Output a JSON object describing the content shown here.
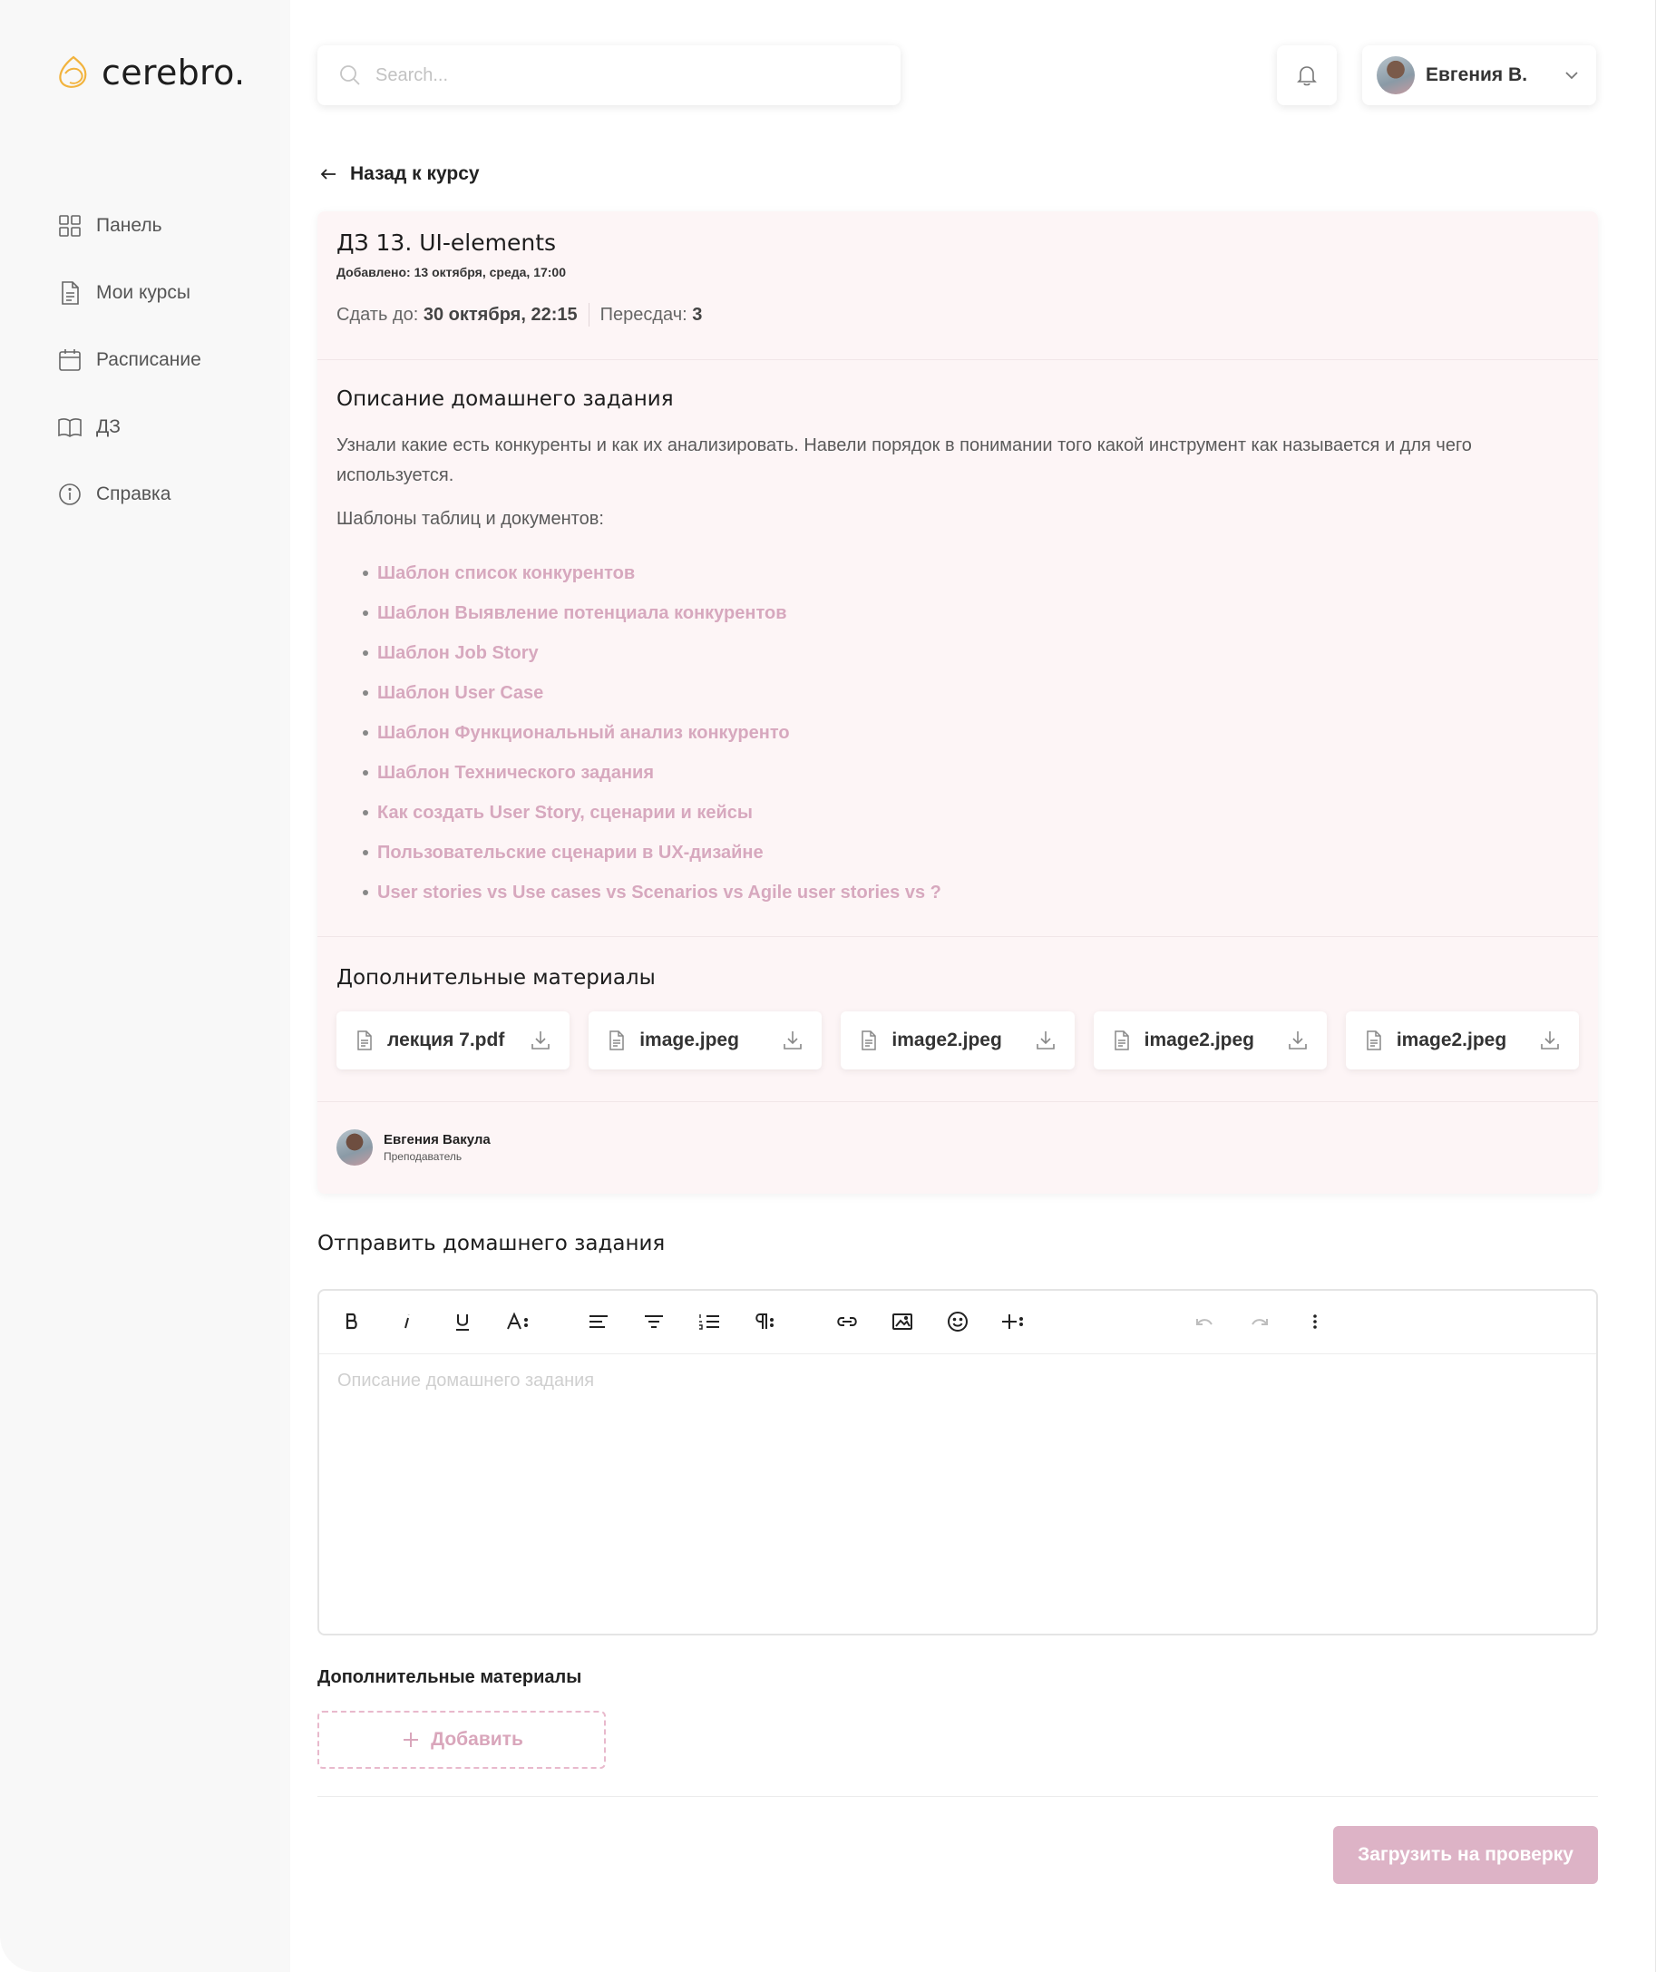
{
  "app": {
    "logo_text": "cerebro."
  },
  "sidebar": {
    "items": [
      {
        "label": "Панель",
        "icon": "grid-icon"
      },
      {
        "label": "Мои курсы",
        "icon": "document-icon"
      },
      {
        "label": "Расписание",
        "icon": "calendar-icon"
      },
      {
        "label": "ДЗ",
        "icon": "book-icon"
      },
      {
        "label": "Справка",
        "icon": "info-icon"
      }
    ]
  },
  "header": {
    "search_placeholder": "Search...",
    "user_name": "Евгения В."
  },
  "back_label": "Назад к курсу",
  "assignment": {
    "title": "ДЗ 13. UI-elements",
    "added": "Добавлено: 13 октября, среда, 17:00",
    "deadline_label": "Сдать до:",
    "deadline_value": "30 октября, 22:15",
    "retakes_label": "Пересдач:",
    "retakes_value": "3",
    "description_heading": "Описание домашнего задания",
    "description_text": "Узнали какие есть конкуренты и как их анализировать. Навели порядок в понимании того какой инструмент как называется и для чего используется.",
    "templates_label": "Шаблоны таблиц и документов:",
    "links": [
      "Шаблон список конкурентов",
      "Шаблон Выявление потенциала конкурентов",
      "Шаблон Job Story",
      "Шаблон User Case",
      "Шаблон Функциональный анализ конкуренто",
      "Шаблон Технического задания",
      "Как создать User Story, сценарии и кейсы",
      "Пользовательские сценарии в UX-дизайне",
      "User stories vs Use cases vs Scenarios vs Agile user stories vs ?"
    ],
    "materials_heading": "Дополнительные материалы",
    "files": [
      "лекция 7.pdf",
      "image.jpeg",
      "image2.jpeg",
      "image2.jpeg",
      "image2.jpeg"
    ],
    "author_name": "Евгения Вакула",
    "author_role": "Преподаватель"
  },
  "submit": {
    "title": "Отправить домашнего задания",
    "editor_placeholder": "Описание домашнего задания",
    "extra_label": "Дополнительные материалы",
    "add_label": "Добавить",
    "upload_label": "Загрузить на проверку"
  },
  "colors": {
    "accent": "#ddb3c6",
    "link": "#d7a8be",
    "card_bg": "#fdf5f6",
    "logo": "#f2b33d"
  }
}
